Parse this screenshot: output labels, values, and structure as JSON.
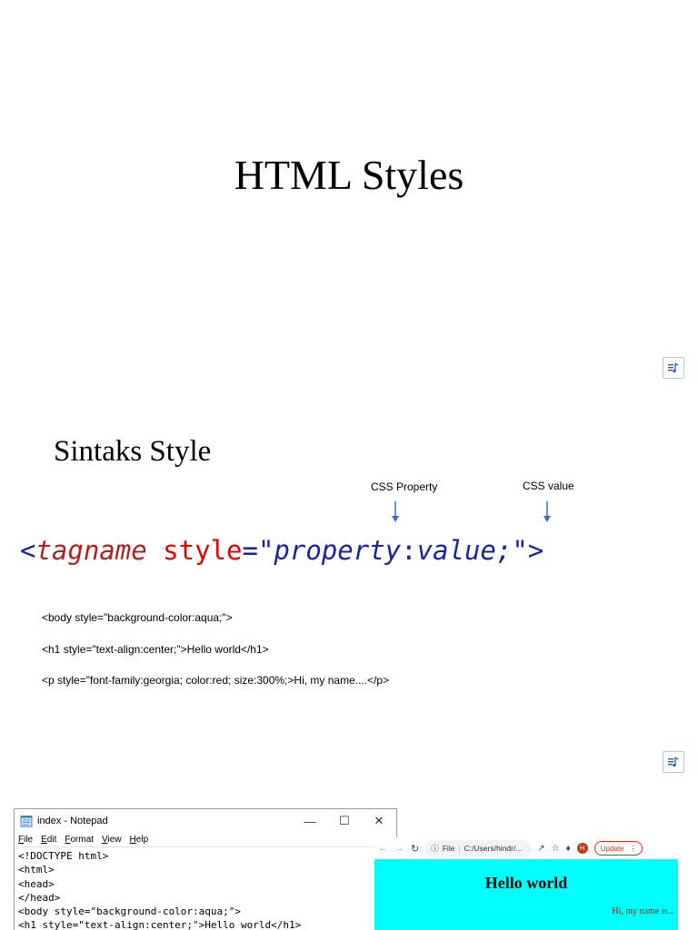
{
  "slide1": {
    "title": "HTML Styles"
  },
  "slide2": {
    "heading": "Sintaks Style",
    "annotations": {
      "property": "CSS Property",
      "value": "CSS value"
    },
    "syntax": {
      "open": "<",
      "tagname": "tagname",
      "attr": "style",
      "eq": "=",
      "quote_open": "\"",
      "property": "property",
      "colon": ":",
      "value": "value;",
      "quote_close": "\"",
      "close": ">"
    },
    "examples": [
      "<body style=\"background-color:aqua;\">",
      "<h1 style=\"text-align:center;\">Hello world</h1>",
      "<p style=\"font-family:georgia; color:red; size:300%;>Hi, my name....</p>"
    ]
  },
  "notepad": {
    "title": "index - Notepad",
    "menu": [
      "File",
      "Edit",
      "Format",
      "View",
      "Help"
    ],
    "code": "<!DOCTYPE html>\n<html>\n<head>\n</head>\n<body style=\"background-color:aqua;\">\n<h1 style=\"text-align:center;\">Hello world</h1>"
  },
  "browser": {
    "url_prefix": "File",
    "url": "C:/Users/hindr/...",
    "avatar": "H",
    "update_label": "Update",
    "page_heading": "Hello world",
    "page_paragraph": "Hi, my name is..."
  },
  "colors": {
    "syntax_blue": "#1a22a8",
    "syntax_red": "#e20000",
    "aqua": "#00ffff"
  },
  "icons": [
    "audio-icon",
    "arrow-down-icon",
    "notepad-icon",
    "minimize-icon",
    "maximize-icon",
    "close-icon",
    "back-icon",
    "forward-icon",
    "reload-icon",
    "info-icon",
    "share-icon",
    "star-icon",
    "extensions-icon",
    "kebab-icon"
  ]
}
